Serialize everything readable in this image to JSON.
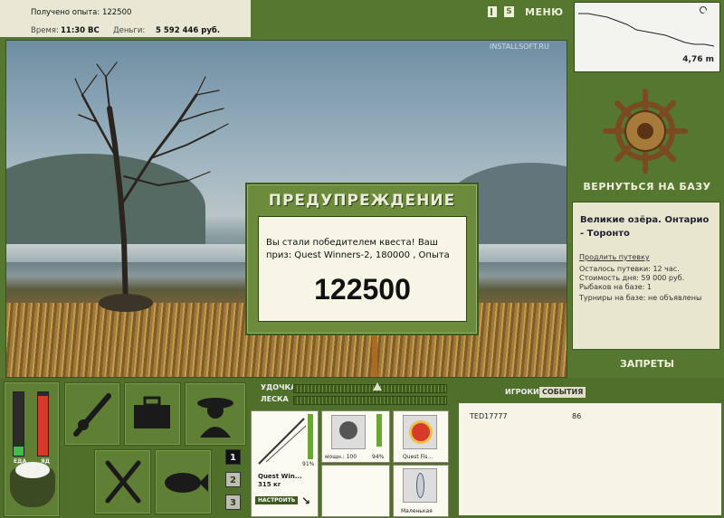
{
  "info": {
    "xp_line": "Получено опыта: 122500",
    "time_label": "Время:",
    "time_value": "11:30 ВС",
    "money_label": "Деньги:",
    "money_value": "5 592 446 руб."
  },
  "controls": {
    "sound_icon": "S",
    "menu_label": "МЕНЮ",
    "close_label": "×"
  },
  "watermark": "INSTALLSOFT.RU",
  "depth_map": {
    "depth_value": "4,76 m",
    "depth_profile": [
      3,
      3,
      4,
      5,
      7,
      9,
      12,
      13,
      14,
      15,
      17,
      19,
      20,
      20,
      21
    ]
  },
  "dialog": {
    "title": "ПРЕДУПРЕЖДЕНИЕ",
    "message": "Вы стали победителем квеста! Ваш приз: Quest Winners-2, 180000 , Опыта",
    "value": "122500"
  },
  "right_panel": {
    "return_label": "ВЕРНУТЬСЯ НА БАЗУ",
    "location_title": "Великие озёра. Онтарио - Торонто",
    "extend_link": "Продлить путевку",
    "remaining": "Осталось путевки: 12 час.",
    "day_cost": "Стоимость дня: 59 000 руб.",
    "fishers": "Рыбаков на базе: 1",
    "tournaments": "Турниры на базе: не объявлены",
    "bans_label": "ЗАПРЕТЫ"
  },
  "status": {
    "food_label": "ЕДА",
    "poison_label": "ЯД",
    "food_level": 0.15,
    "poison_level": 0.95
  },
  "pages": [
    "1",
    "2",
    "3"
  ],
  "gear": {
    "rod_label": "УДОЧКА",
    "line_label": "ЛЕСКА",
    "rod_name": "Quest Win...",
    "rod_weight": "315 кг",
    "rod_pct": "91%",
    "setup_label": "НАСТРОИТЬ",
    "reel_power": "мощн.: 100",
    "reel_pct": "94%",
    "line_name": "Quest Fis...",
    "lure_name": "Маленькая"
  },
  "events": {
    "tab_players": "ИГРОКИ",
    "tab_events": "СОБЫТИЯ",
    "rows": [
      {
        "name": "TED17777",
        "value": "86"
      }
    ]
  },
  "colors": {
    "panel_green": "#55772f",
    "paper": "#e9e8d4",
    "accent_red": "#d83a2a"
  }
}
